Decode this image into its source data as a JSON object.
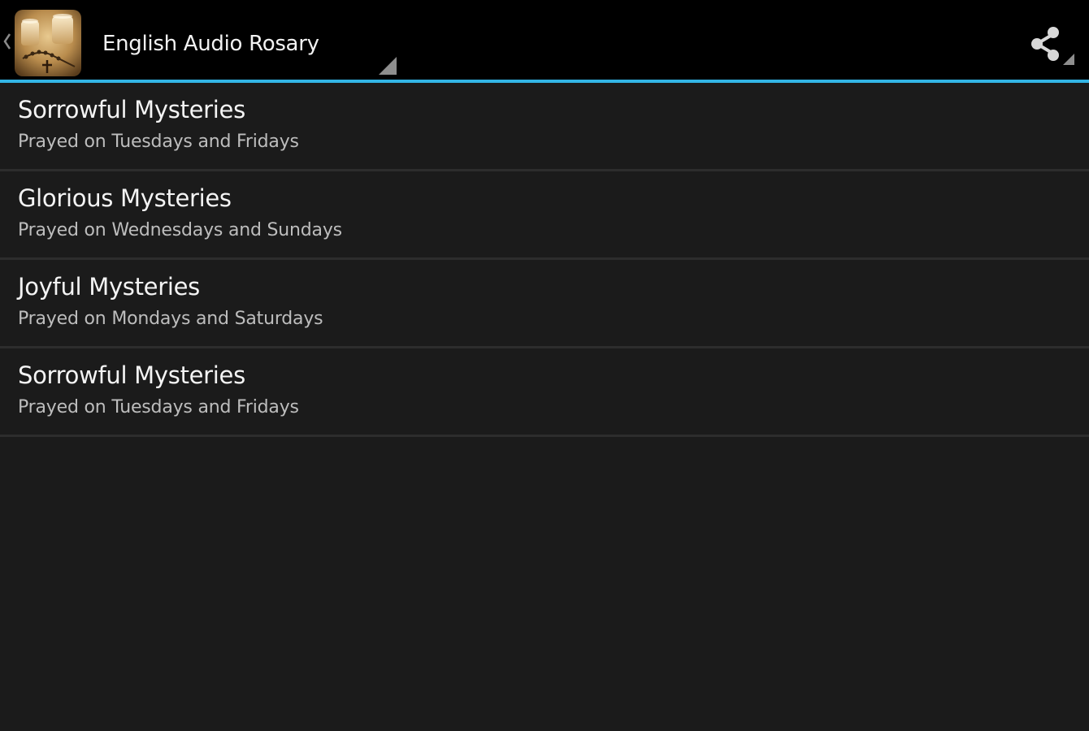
{
  "action_bar": {
    "title": "English Audio Rosary",
    "app_icon": "rosary-candles-icon",
    "share_icon": "share-icon",
    "accent_color": "#33b5e5"
  },
  "mysteries": [
    {
      "title": "Sorrowful Mysteries",
      "subtitle": "Prayed on Tuesdays and Fridays"
    },
    {
      "title": "Glorious Mysteries",
      "subtitle": "Prayed on Wednesdays and Sundays"
    },
    {
      "title": "Joyful Mysteries",
      "subtitle": "Prayed on Mondays and Saturdays"
    },
    {
      "title": "Sorrowful Mysteries",
      "subtitle": "Prayed on Tuesdays and Fridays"
    }
  ]
}
